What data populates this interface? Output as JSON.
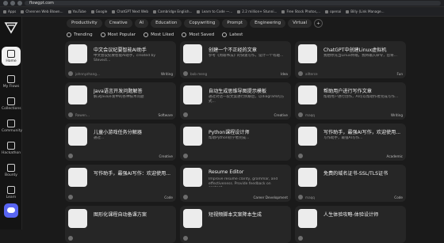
{
  "browser": {
    "url": "flowgpt.com",
    "bookmarks": [
      "Apps",
      "Chennen Web Blown...",
      "YouTube",
      "Google",
      "ChatGPT Next Web",
      "Cambridge English...",
      "Learn to Code —...",
      "2.2 million+ Stunni...",
      "Free Stock Photos,...",
      "openai",
      "Billy (Link Manage..."
    ]
  },
  "sidebar": {
    "items": [
      {
        "label": "Home"
      },
      {
        "label": "My Flows"
      },
      {
        "label": "Collections"
      },
      {
        "label": "Community"
      },
      {
        "label": "Hackathon"
      },
      {
        "label": "Bounty"
      },
      {
        "label": "Learn"
      }
    ]
  },
  "filters": [
    "Productivity",
    "Creative",
    "AI",
    "Education",
    "Copywriting",
    "Prompt",
    "Engineering",
    "Virtual",
    "+"
  ],
  "sort": [
    "Trending",
    "Most Popular",
    "Most Liked",
    "Most Saved",
    "Latest"
  ],
  "cards": [
    {
      "title": "中文会议纪要智能AI助手",
      "desc": "中文会议纪要智能AI助手，created by Stevect...",
      "author": "johnnyzhang...",
      "tag": "Writing"
    },
    {
      "title": "创建一个不正经的文章",
      "desc": "参考《周瑜书法》的快速写作，设计一个有趣...",
      "author": "bob meng",
      "tag": "Idea"
    },
    {
      "title": "ChatGPT中创建Linux虚拟机",
      "desc": "我想你充当Linux终端。我将输入命令，您将...",
      "author": "allterce",
      "tag": "Fun"
    },
    {
      "title": "Java语言开发问题解答",
      "desc": "解决Java开发中的各种技术问题",
      "author": "Rowen...",
      "tag": "Software"
    },
    {
      "title": "自动生成思维导图提示模板",
      "desc": "通过对话一段文案进行拆解后，以diagram的方式...",
      "author": "",
      "tag": "Creative"
    },
    {
      "title": "帮助用户进行写作文章",
      "desc": "帮助用户进行创作，AI可以帮助作者完成写作...",
      "author": "maqq",
      "tag": "Writing"
    },
    {
      "title": "儿童小游戏任务分解器",
      "desc": "通过...",
      "author": "",
      "tag": "Creative"
    },
    {
      "title": "Python课程设计师",
      "desc": "帮助Python初学者完成...",
      "author": "",
      "tag": ""
    },
    {
      "title": "写作助手，最强AI写作，欢迎使用...",
      "desc": "写作助手，最强AI写作...",
      "author": "",
      "tag": "Academic"
    },
    {
      "title": "写作助手，最强AI写作：欢迎使用...",
      "desc": "",
      "author": "",
      "tag": "Code"
    },
    {
      "title": "Resume Editor",
      "desc": "Improve resume clarity, grammar, and effectiveness. Provide feedback on content...",
      "author": "",
      "tag": "Career Development"
    },
    {
      "title": "免费的域名证书-SSL/TLS证书",
      "desc": "",
      "author": "maqq",
      "tag": "Code"
    },
    {
      "title": "图形化课程自动备课方案",
      "desc": "",
      "author": "",
      "tag": ""
    },
    {
      "title": "短视频脚本文案降本生成",
      "desc": "",
      "author": "",
      "tag": ""
    },
    {
      "title": "人生体验攻略-体验设计师",
      "desc": "",
      "author": "",
      "tag": ""
    }
  ]
}
